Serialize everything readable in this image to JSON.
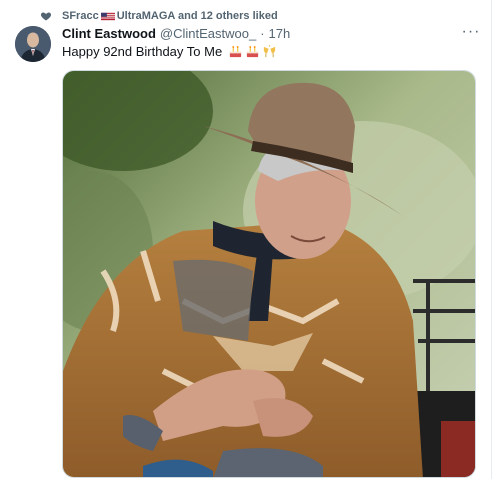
{
  "social_context": {
    "icon": "heart-icon",
    "prefix": "SFracc",
    "flag": "us-flag-icon",
    "suffix": "UltraMAGA and 12 others liked"
  },
  "tweet": {
    "author_name": "Clint Eastwood",
    "author_handle": "@ClintEastwoo_",
    "separator": "·",
    "timestamp": "17h",
    "more_icon": "more-options-icon",
    "more_glyph": "···",
    "text": "Happy 92nd Birthday To Me",
    "emojis": [
      "birthday-cake-icon",
      "birthday-cake-icon",
      "clinking-glasses-icon"
    ]
  },
  "colors": {
    "muted": "#536471",
    "text": "#0f1419",
    "border": "#cfd9de"
  }
}
